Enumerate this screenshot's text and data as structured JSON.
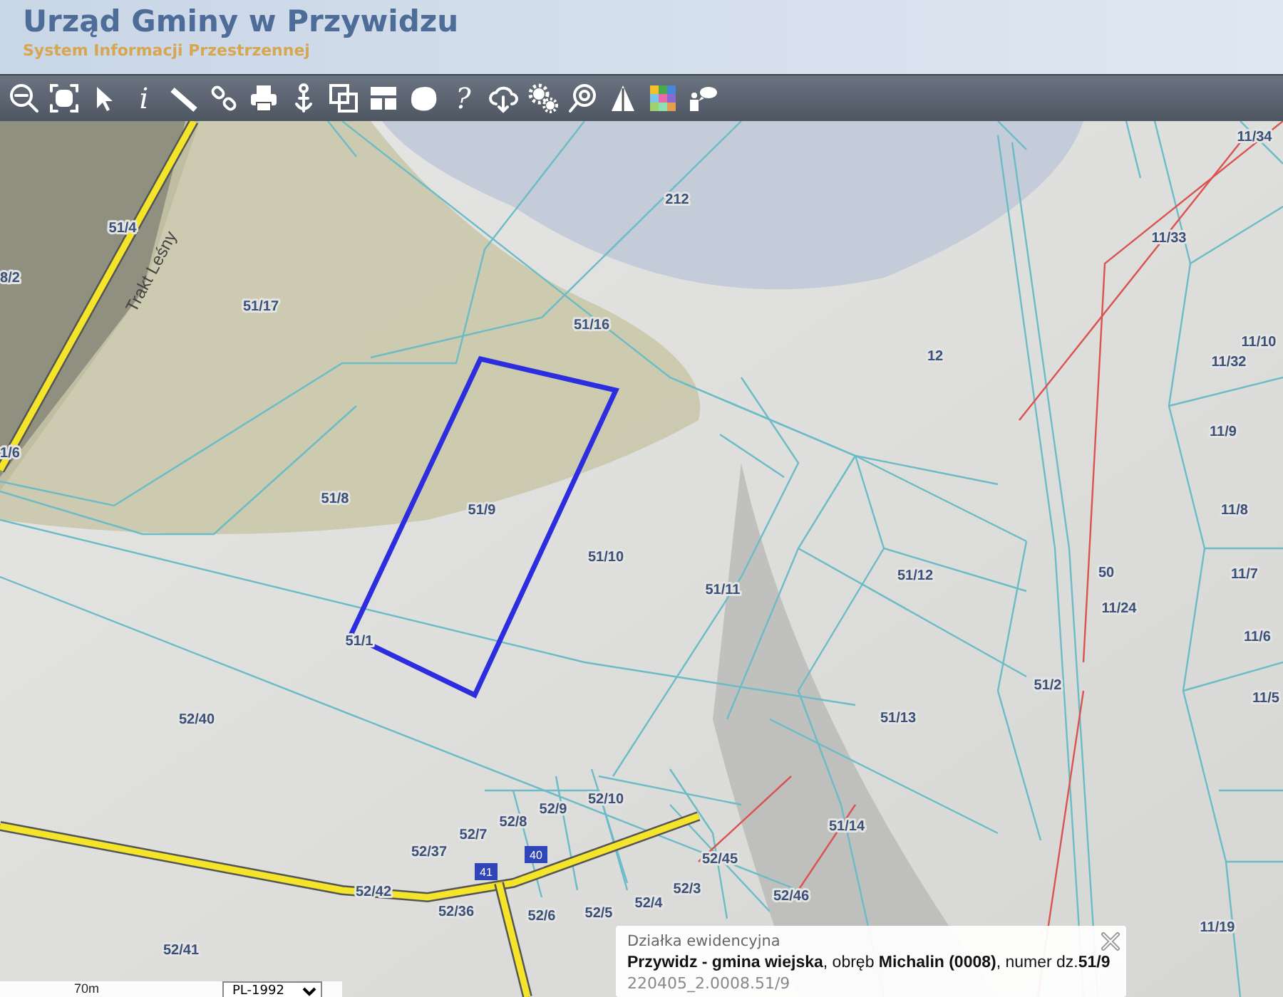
{
  "header": {
    "title": "Urząd Gminy w Przywidzu",
    "subtitle": "System Informacji Przestrzennej"
  },
  "toolbar": {
    "info_label": "i",
    "help_label": "?"
  },
  "map": {
    "roads": [
      {
        "name": "Trakt Leśny"
      }
    ],
    "parcels": [
      {
        "label": "212",
        "selected": false
      },
      {
        "label": "51/16",
        "selected": false
      },
      {
        "label": "12",
        "selected": false
      },
      {
        "label": "51/17",
        "selected": false
      },
      {
        "label": "51/4",
        "selected": false
      },
      {
        "label": "8/2",
        "selected": false
      },
      {
        "label": "1/6",
        "selected": false
      },
      {
        "label": "51/8",
        "selected": false
      },
      {
        "label": "51/9",
        "selected": true
      },
      {
        "label": "51/10",
        "selected": false
      },
      {
        "label": "51/11",
        "selected": false
      },
      {
        "label": "51/12",
        "selected": false
      },
      {
        "label": "51/1",
        "selected": false
      },
      {
        "label": "51/13",
        "selected": false
      },
      {
        "label": "51/14",
        "selected": false
      },
      {
        "label": "51/2",
        "selected": false
      },
      {
        "label": "50",
        "selected": false
      },
      {
        "label": "11/24",
        "selected": false
      },
      {
        "label": "11/34",
        "selected": false
      },
      {
        "label": "11/33",
        "selected": false
      },
      {
        "label": "11/10",
        "selected": false
      },
      {
        "label": "11/32",
        "selected": false
      },
      {
        "label": "11/9",
        "selected": false
      },
      {
        "label": "11/8",
        "selected": false
      },
      {
        "label": "11/7",
        "selected": false
      },
      {
        "label": "11/6",
        "selected": false
      },
      {
        "label": "11/5",
        "selected": false
      },
      {
        "label": "52/40",
        "selected": false
      },
      {
        "label": "52/10",
        "selected": false
      },
      {
        "label": "52/9",
        "selected": false
      },
      {
        "label": "52/8",
        "selected": false
      },
      {
        "label": "52/7",
        "selected": false
      },
      {
        "label": "52/37",
        "selected": false
      },
      {
        "label": "52/45",
        "selected": false
      },
      {
        "label": "52/42",
        "selected": false
      },
      {
        "label": "52/3",
        "selected": false
      },
      {
        "label": "52/46",
        "selected": false
      },
      {
        "label": "52/4",
        "selected": false
      },
      {
        "label": "52/36",
        "selected": false
      },
      {
        "label": "52/6",
        "selected": false
      },
      {
        "label": "52/5",
        "selected": false
      },
      {
        "label": "52/41",
        "selected": false
      },
      {
        "label": "11/19",
        "selected": false
      }
    ],
    "house_numbers": [
      "41",
      "40"
    ]
  },
  "popup": {
    "title": "Działka ewidencyjna",
    "description": "**Przywidz - gmina wiejska**, obręb **Michalin (0008)**, numer dz.**51/9**",
    "identifier": "220405_2.0008.51/9"
  },
  "scale": {
    "label": "70m",
    "projection": "PL-1992"
  }
}
